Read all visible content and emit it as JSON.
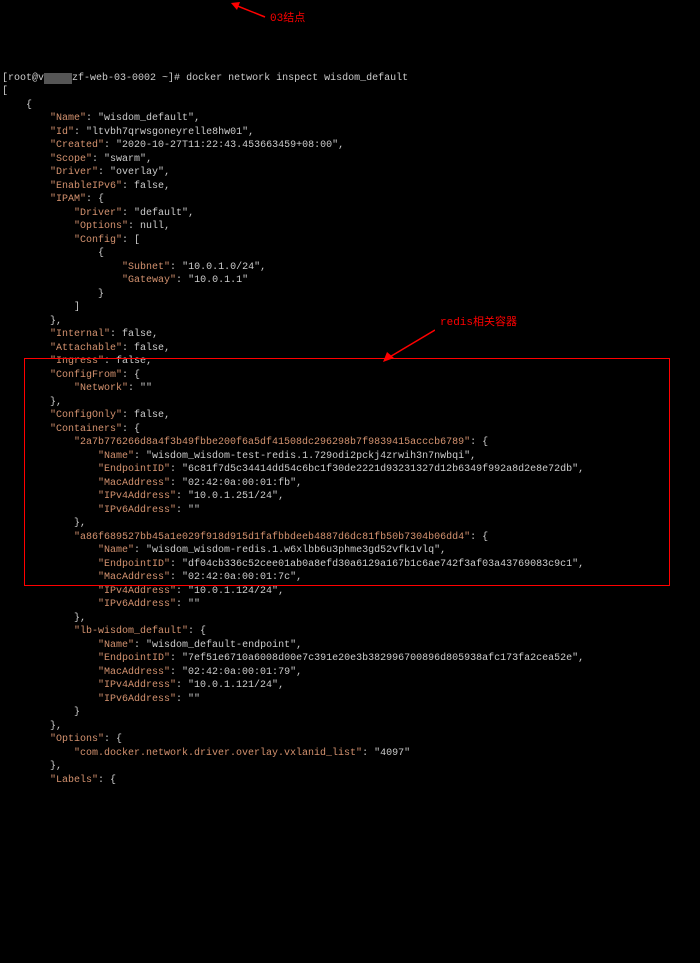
{
  "prompt": {
    "user": "[root@v",
    "host_suffix": "zf-web-03-0002 ~]#",
    "command": "docker network inspect wisdom_default"
  },
  "annotations": {
    "node03": "03结点",
    "redis": "redis相关容器"
  },
  "network": {
    "name_key": "\"Name\"",
    "name_val": "\"wisdom_default\"",
    "id_key": "\"Id\"",
    "id_val": "\"ltvbh7qrwsgoneyrelle8hw01\"",
    "created_key": "\"Created\"",
    "created_val": "\"2020-10-27T11:22:43.453663459+08:00\"",
    "scope_key": "\"Scope\"",
    "scope_val": "\"swarm\"",
    "driver_key": "\"Driver\"",
    "driver_val": "\"overlay\"",
    "enableipv6_key": "\"EnableIPv6\"",
    "enableipv6_val": "false",
    "ipam_key": "\"IPAM\"",
    "ipam_driver_key": "\"Driver\"",
    "ipam_driver_val": "\"default\"",
    "ipam_options_key": "\"Options\"",
    "ipam_options_val": "null",
    "ipam_config_key": "\"Config\"",
    "subnet_key": "\"Subnet\"",
    "subnet_val": "\"10.0.1.0/24\"",
    "gateway_key": "\"Gateway\"",
    "gateway_val": "\"10.0.1.1\"",
    "internal_key": "\"Internal\"",
    "internal_val": "false",
    "attachable_key": "\"Attachable\"",
    "attachable_val": "false",
    "ingress_key": "\"Ingress\"",
    "ingress_val": "false",
    "configfrom_key": "\"ConfigFrom\"",
    "network_key": "\"Network\"",
    "network_val": "\"\"",
    "configonly_key": "\"ConfigOnly\"",
    "configonly_val": "false",
    "containers_key": "\"Containers\"",
    "c1_id": "\"2a7b776266d8a4f3b49fbbe200f6a5df41508dc296298b7f9839415acccb6789\"",
    "c1_name_key": "\"Name\"",
    "c1_name_val": "\"wisdom_wisdom-test-redis.1.729odi2pckj4zrwih3n7nwbqi\"",
    "c1_ep_key": "\"EndpointID\"",
    "c1_ep_val": "\"6c81f7d5c34414dd54c6bc1f30de2221d93231327d12b6349f992a8d2e8e72db\"",
    "c1_mac_key": "\"MacAddress\"",
    "c1_mac_val": "\"02:42:0a:00:01:fb\"",
    "c1_ipv4_key": "\"IPv4Address\"",
    "c1_ipv4_val": "\"10.0.1.251/24\"",
    "c1_ipv6_key": "\"IPv6Address\"",
    "c1_ipv6_val": "\"\"",
    "c2_id": "\"a86f689527bb45a1e029f918d915d1fafbbdeeb4887d6dc81fb50b7304b06dd4\"",
    "c2_name_key": "\"Name\"",
    "c2_name_val": "\"wisdom_wisdom-redis.1.w6xlbb6u3phme3gd52vfk1vlq\"",
    "c2_ep_key": "\"EndpointID\"",
    "c2_ep_val": "\"df04cb336c52cee01ab0a8efd30a6129a167b1c6ae742f3af03a43769083c9c1\"",
    "c2_mac_key": "\"MacAddress\"",
    "c2_mac_val": "\"02:42:0a:00:01:7c\"",
    "c2_ipv4_key": "\"IPv4Address\"",
    "c2_ipv4_val": "\"10.0.1.124/24\"",
    "c2_ipv6_key": "\"IPv6Address\"",
    "c2_ipv6_val": "\"\"",
    "c3_id": "\"lb-wisdom_default\"",
    "c3_name_key": "\"Name\"",
    "c3_name_val": "\"wisdom_default-endpoint\"",
    "c3_ep_key": "\"EndpointID\"",
    "c3_ep_val": "\"7ef51e6710a6008d00e7c391e20e3b382996700896d805938afc173fa2cea52e\"",
    "c3_mac_key": "\"MacAddress\"",
    "c3_mac_val": "\"02:42:0a:00:01:79\"",
    "c3_ipv4_key": "\"IPv4Address\"",
    "c3_ipv4_val": "\"10.0.1.121/24\"",
    "c3_ipv6_key": "\"IPv6Address\"",
    "c3_ipv6_val": "\"\"",
    "options_key": "\"Options\"",
    "vxlan_key": "\"com.docker.network.driver.overlay.vxlanid_list\"",
    "vxlan_val": "\"4097\"",
    "labels_key": "\"Labels\""
  }
}
